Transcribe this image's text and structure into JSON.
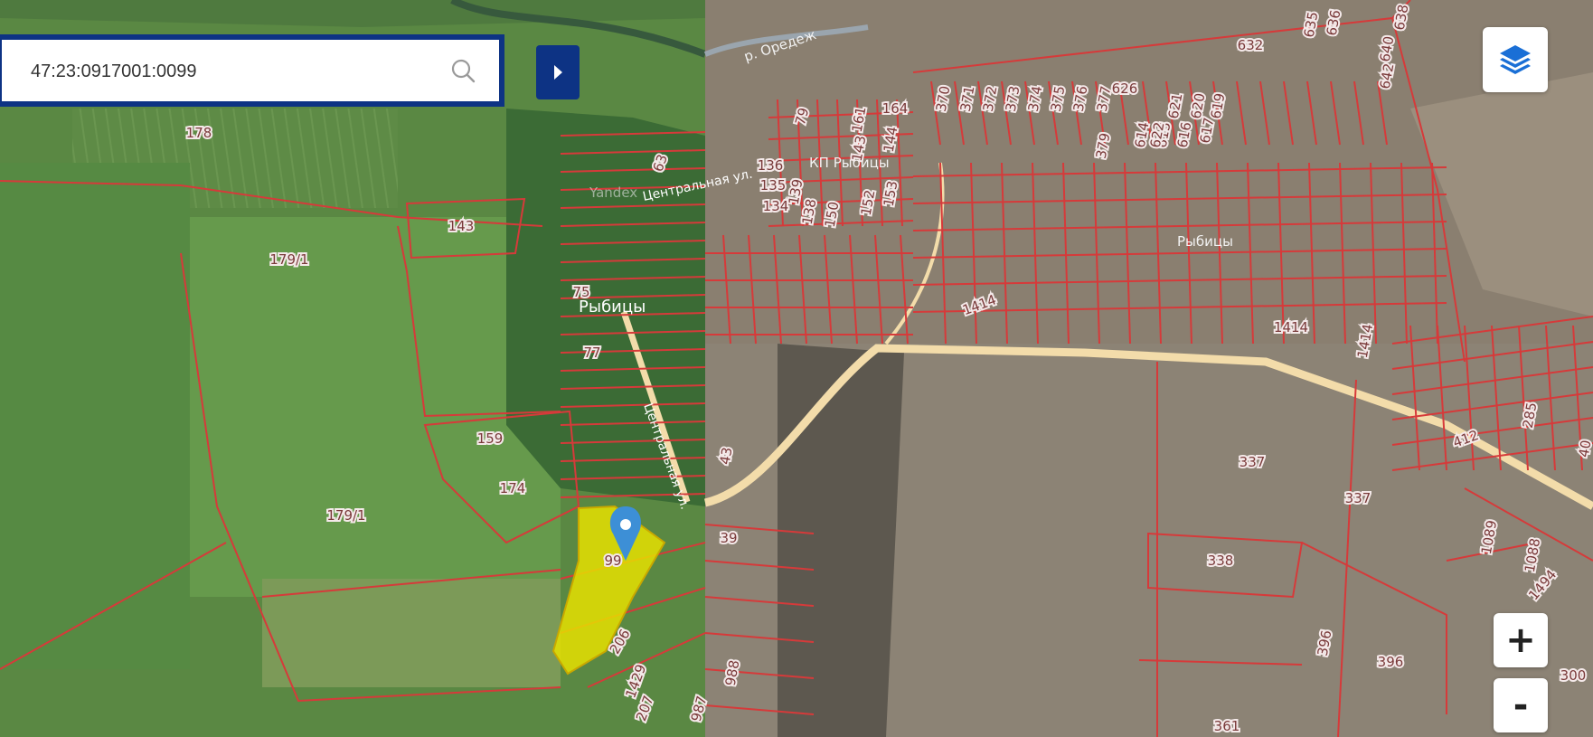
{
  "search": {
    "value": "47:23:0917001:0099"
  },
  "controls": {
    "zoom_in": "+",
    "zoom_out": "-"
  },
  "places": {
    "village": "Рыбицы",
    "kp": "КП Рыбицы",
    "village_right": "Рыбицы",
    "river": "р. Оредеж",
    "street_top": "Центральная ул.",
    "street_vertical": "Центральная ул.",
    "watermark": "Yandex"
  },
  "plots": {
    "p178": "178",
    "p143": "143",
    "p179a": "179/1",
    "p179b": "179/1",
    "p159": "159",
    "p174": "174",
    "p99": "99",
    "p206": "206",
    "p1429": "1429",
    "p207": "207",
    "p987": "987",
    "p988": "988",
    "p39": "39",
    "p43": "43",
    "p77": "77",
    "p75": "75",
    "p63": "63",
    "p79": "79",
    "p136": "136",
    "p135": "135",
    "p134": "134",
    "p139": "139",
    "p138": "138",
    "p150": "150",
    "p152": "152",
    "p153": "153",
    "p161": "161",
    "p164": "164",
    "p144": "144",
    "p143b": "143",
    "p370": "370",
    "p371": "371",
    "p372": "372",
    "p373": "373",
    "p374": "374",
    "p375": "375",
    "p376": "376",
    "p377": "377",
    "p379": "379",
    "p626": "626",
    "p614": "614",
    "p615": "615",
    "p616": "616",
    "p617": "617",
    "p619": "619",
    "p621": "621",
    "p622": "622",
    "p620": "620",
    "p632": "632",
    "p635": "635",
    "p636": "636",
    "p638": "638",
    "p640": "640",
    "p642": "642",
    "p1414a": "1414",
    "p1414b": "1414",
    "p1414c": "1414",
    "p337a": "337",
    "p337b": "337",
    "p338": "338",
    "p396a": "396",
    "p396b": "396",
    "p361": "361",
    "p412": "412",
    "p285": "285",
    "p40": "40",
    "p1089": "1089",
    "p1088": "1088",
    "p1494": "1494",
    "p300": "300"
  },
  "colors": {
    "plot_border": "#d63a3a",
    "selected_plot": "#e6e000",
    "marker": "#3d8fd6",
    "panel_blue": "#0d3384",
    "road": "#f3dcaa"
  },
  "icons": {
    "search": "search-icon",
    "toggle": "chevron-right-icon",
    "layers": "layers-icon",
    "marker": "map-pin-icon"
  }
}
